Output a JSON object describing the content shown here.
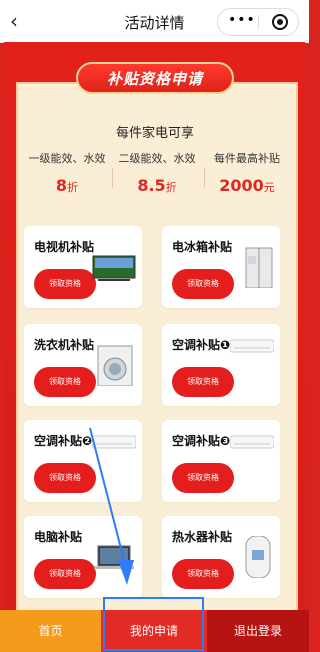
{
  "topbar": {
    "back_icon": "‹",
    "title": "活动详情",
    "menu_icon": "•••"
  },
  "banner": {
    "title": "补贴资格申请"
  },
  "info": {
    "headline": "每件家电可享",
    "items": [
      {
        "label": "一级能效、水效",
        "value": "8",
        "unit": "折"
      },
      {
        "label": "二级能效、水效",
        "value": "8.5",
        "unit": "折"
      },
      {
        "label": "每件最高补贴",
        "value": "2000",
        "unit": "元"
      }
    ]
  },
  "cards": [
    {
      "label": "电视机补贴",
      "button": "领取资格",
      "icon": "tv-icon"
    },
    {
      "label": "电冰箱补贴",
      "button": "领取资格",
      "icon": "fridge-icon"
    },
    {
      "label": "洗衣机补贴",
      "button": "领取资格",
      "icon": "washer-icon"
    },
    {
      "label": "空调补贴❶",
      "button": "领取资格",
      "icon": "ac-icon"
    },
    {
      "label": "空调补贴❷",
      "button": "领取资格",
      "icon": "ac-icon"
    },
    {
      "label": "空调补贴❸",
      "button": "领取资格",
      "icon": "ac-icon"
    },
    {
      "label": "电脑补贴",
      "button": "领取资格",
      "icon": "laptop-icon"
    },
    {
      "label": "热水器补贴",
      "button": "领取资格",
      "icon": "water-heater-icon"
    }
  ],
  "bottom": {
    "home": "首页",
    "mine": "我的申请",
    "exit": "退出登录"
  },
  "colors": {
    "accent": "#e41e1c",
    "frame": "#fbeed7",
    "home": "#f49b1c",
    "highlight": "#2f7df6"
  }
}
